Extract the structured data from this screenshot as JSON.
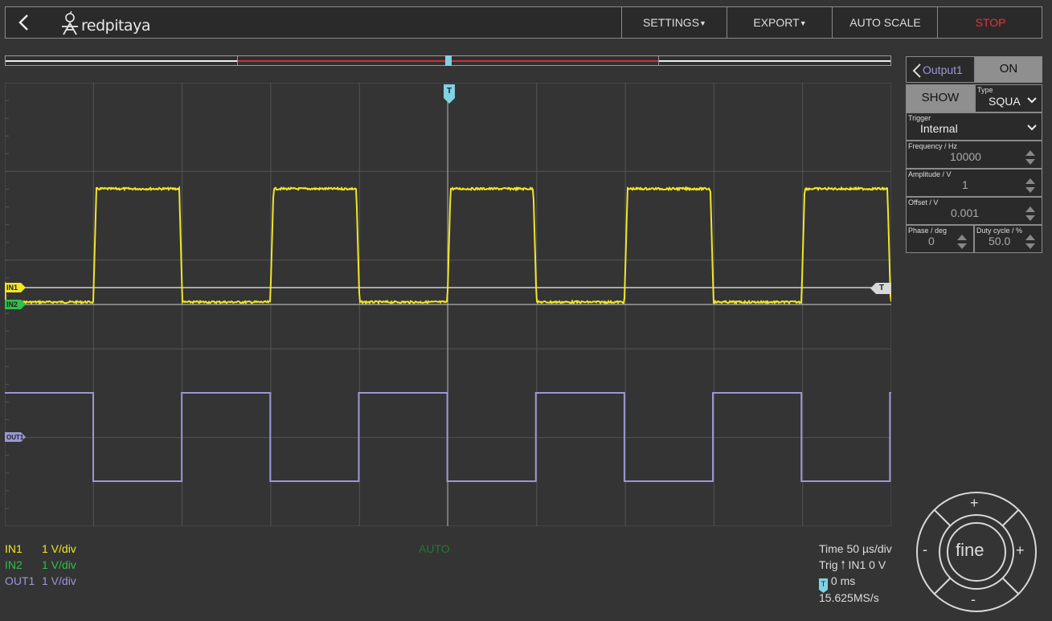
{
  "header": {
    "logo_text": "redpitaya",
    "settings_label": "SETTINGS",
    "export_label": "EXPORT",
    "autoscale_label": "AUTO SCALE",
    "stop_label": "STOP"
  },
  "scope": {
    "trigger_marker": "T",
    "trigger_level_marker": "T",
    "channel_markers": {
      "in1": "IN1",
      "in2": "IN2",
      "out1": "OUT1"
    },
    "colors": {
      "in1": "#f2e52a",
      "in2": "#2fbf4a",
      "out1": "#9b97d6",
      "trigger": "#7fd3e3"
    }
  },
  "output_panel": {
    "output_label": "Output1",
    "on_label": "ON",
    "show_label": "SHOW",
    "type_label": "Type",
    "type_value": "SQUA",
    "trigger_label": "Trigger",
    "trigger_value": "Internal",
    "frequency_label": "Frequency / Hz",
    "frequency_value": "10000",
    "amplitude_label": "Amplitude / V",
    "amplitude_value": "1",
    "offset_label": "Offset / V",
    "offset_value": "0.001",
    "phase_label": "Phase / deg",
    "phase_value": "0",
    "duty_label": "Duty cycle / %",
    "duty_value": "50.0"
  },
  "status": {
    "in1_name": "IN1",
    "in1_scale": "1 V/div",
    "in2_name": "IN2",
    "in2_scale": "1 V/div",
    "out1_name": "OUT1",
    "out1_scale": "1 V/div",
    "mode": "AUTO",
    "time": "Time 50 µs/div",
    "trig": "Trig",
    "trig_source": "IN1 0 V",
    "trig_delay_marker": "T",
    "trig_delay": "0 ms",
    "sample_rate": "15.625MS/s"
  },
  "joystick": {
    "center_label": "fine",
    "up": "+",
    "down": "-",
    "left": "-",
    "right": "+"
  }
}
